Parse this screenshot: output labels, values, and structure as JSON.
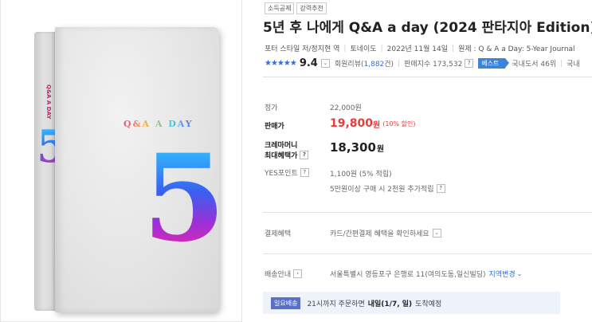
{
  "product_image": {
    "cover_title": "Q&A A DAY",
    "cover_number": "5"
  },
  "tags": [
    "소득공제",
    "강력추천"
  ],
  "title": "5년 후 나에게 Q&A a day (2024 판타지아 Edition)",
  "meta": {
    "authors": "포터 스타일 저/정지현 역",
    "publisher": "토네이도",
    "date": "2022년 11월 14일",
    "original": "원제 : Q & A a Day: 5-Year Journal"
  },
  "rating": {
    "stars": "★★★★★",
    "score": "9.4",
    "reviews_label": "회원리뷰(",
    "reviews_count": "1,882",
    "reviews_suffix": "건)",
    "sales_index": "판매지수 173,532",
    "best_label": "베스트",
    "best_rank": "국내도서 46위",
    "best_more": "국내"
  },
  "price": {
    "list_label": "정가",
    "list_value": "22,000원",
    "sale_label": "판매가",
    "sale_value": "19,800",
    "sale_unit": "원",
    "sale_discount": "(10% 할인)",
    "max_label_1": "크레마머니",
    "max_label_2": "최대혜택가",
    "max_value": "18,300",
    "max_unit": "원",
    "points_label": "YES포인트",
    "points_value": "1,100원 (5% 적립)",
    "points_extra": "5만원이상 구매 시 2천원 추가적립"
  },
  "payment": {
    "label": "결제혜택",
    "value": "카드/간편결제 혜택을 확인하세요"
  },
  "shipping": {
    "label": "배송안내",
    "address": "서울특별시 영등포구 은행로 11(여의도동,일신빌딩)",
    "region_link": "지역변경",
    "badge": "일요배송",
    "text_pre": "21시까지 주문하면",
    "text_bold": "내일(1/7, 일)",
    "text_post": "도착예정"
  },
  "icons": {
    "help": "?",
    "dropdown": "chevron-down-icon",
    "arrow": "chevron-right-icon"
  }
}
